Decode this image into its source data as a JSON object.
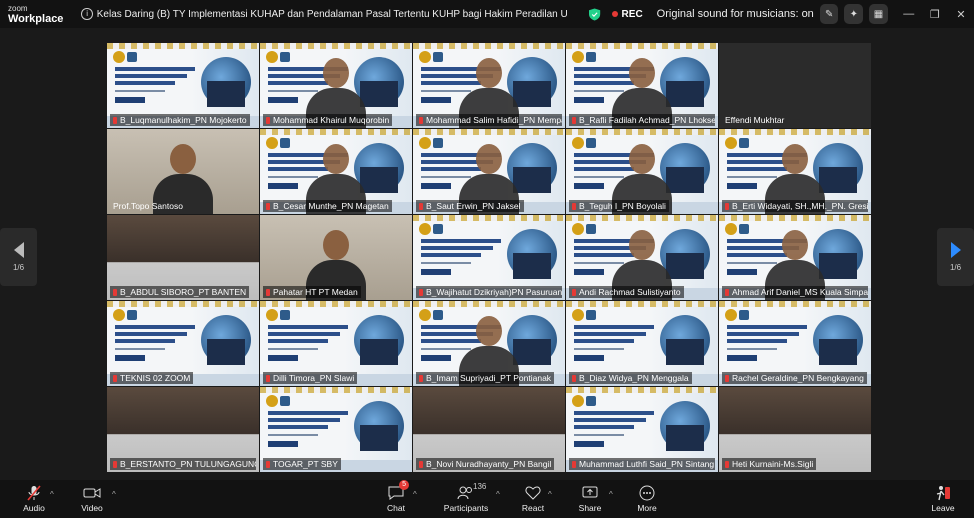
{
  "app": {
    "logo_line1": "zoom",
    "logo_line2": "Workplace"
  },
  "meeting": {
    "title": "Kelas Daring (B) TY Implementasi KUHAP dan Pendalaman Pasal Tertentu KUHP bagi Hakim Peradilan Umum dan Hakim Mahkamah Syariah Aceh (",
    "rec_label": "REC",
    "original_sound": "Original sound for musicians: on"
  },
  "pager": {
    "left": "1/6",
    "right": "1/6"
  },
  "participants": [
    {
      "name": "B_Luqmanulhakim_PN Mojokerto",
      "kind": "slide"
    },
    {
      "name": "Mohammad Khairul Muqorobin",
      "kind": "slide-person"
    },
    {
      "name": "Mohammad Salim Hafidi_PN Mempa...",
      "kind": "slide-person"
    },
    {
      "name": "B_Rafli Fadilah Achmad_PN Lhokseu...",
      "kind": "slide-person"
    },
    {
      "name": "Effendi Mukhtar",
      "kind": "blank",
      "nomute": true
    },
    {
      "name": "Prof.Topo Santoso",
      "kind": "person",
      "active": true,
      "nomute": true
    },
    {
      "name": "B_Cesar Munthe_PN Magetan",
      "kind": "slide-person"
    },
    {
      "name": "B_Saut Erwin_PN Jaksel",
      "kind": "slide-person"
    },
    {
      "name": "B_Teguh I_PN Boyolali",
      "kind": "slide-person"
    },
    {
      "name": "B_Erti Widayati, SH.,MH._PN. Gresik",
      "kind": "slide-person"
    },
    {
      "name": "B_ABDUL SIBORO_PT BANTEN",
      "kind": "room"
    },
    {
      "name": "Pahatar HT PT Medan",
      "kind": "person"
    },
    {
      "name": "B_Wajihatut Dzikriyah)PN Pasuruan",
      "kind": "slide"
    },
    {
      "name": "Andi Rachmad Sulistiyanto",
      "kind": "slide-person"
    },
    {
      "name": "Ahmad Arif Daniel_MS Kuala Simpang",
      "kind": "slide-person"
    },
    {
      "name": "TEKNIS 02 ZOOM",
      "kind": "slide"
    },
    {
      "name": "Dilli Timora_PN Slawi",
      "kind": "slide"
    },
    {
      "name": "B_Imam Supriyadi_PT Pontianak",
      "kind": "slide-person"
    },
    {
      "name": "B_Diaz Widya_PN Menggala",
      "kind": "slide"
    },
    {
      "name": "Rachel Geraldine_PN Bengkayang",
      "kind": "slide"
    },
    {
      "name": "B_ERSTANTO_PN TULUNGAGUNG",
      "kind": "room"
    },
    {
      "name": "TOGAR_PT SBY",
      "kind": "slide"
    },
    {
      "name": "B_Novi Nuradhayanty_PN Bangil",
      "kind": "room"
    },
    {
      "name": "Muhammad Luthfi Said_PN Sintang",
      "kind": "slide"
    },
    {
      "name": "Heti Kurnaini-Ms.Sigli",
      "kind": "room"
    }
  ],
  "toolbar": {
    "audio": "Audio",
    "video": "Video",
    "chat": "Chat",
    "chat_badge": "5",
    "participants": "Participants",
    "participants_count": "136",
    "react": "React",
    "share": "Share",
    "more": "More",
    "leave": "Leave"
  },
  "colors": {
    "active_speaker": "#23d18b",
    "rec": "#e53935",
    "accent": "#2d8cff"
  }
}
